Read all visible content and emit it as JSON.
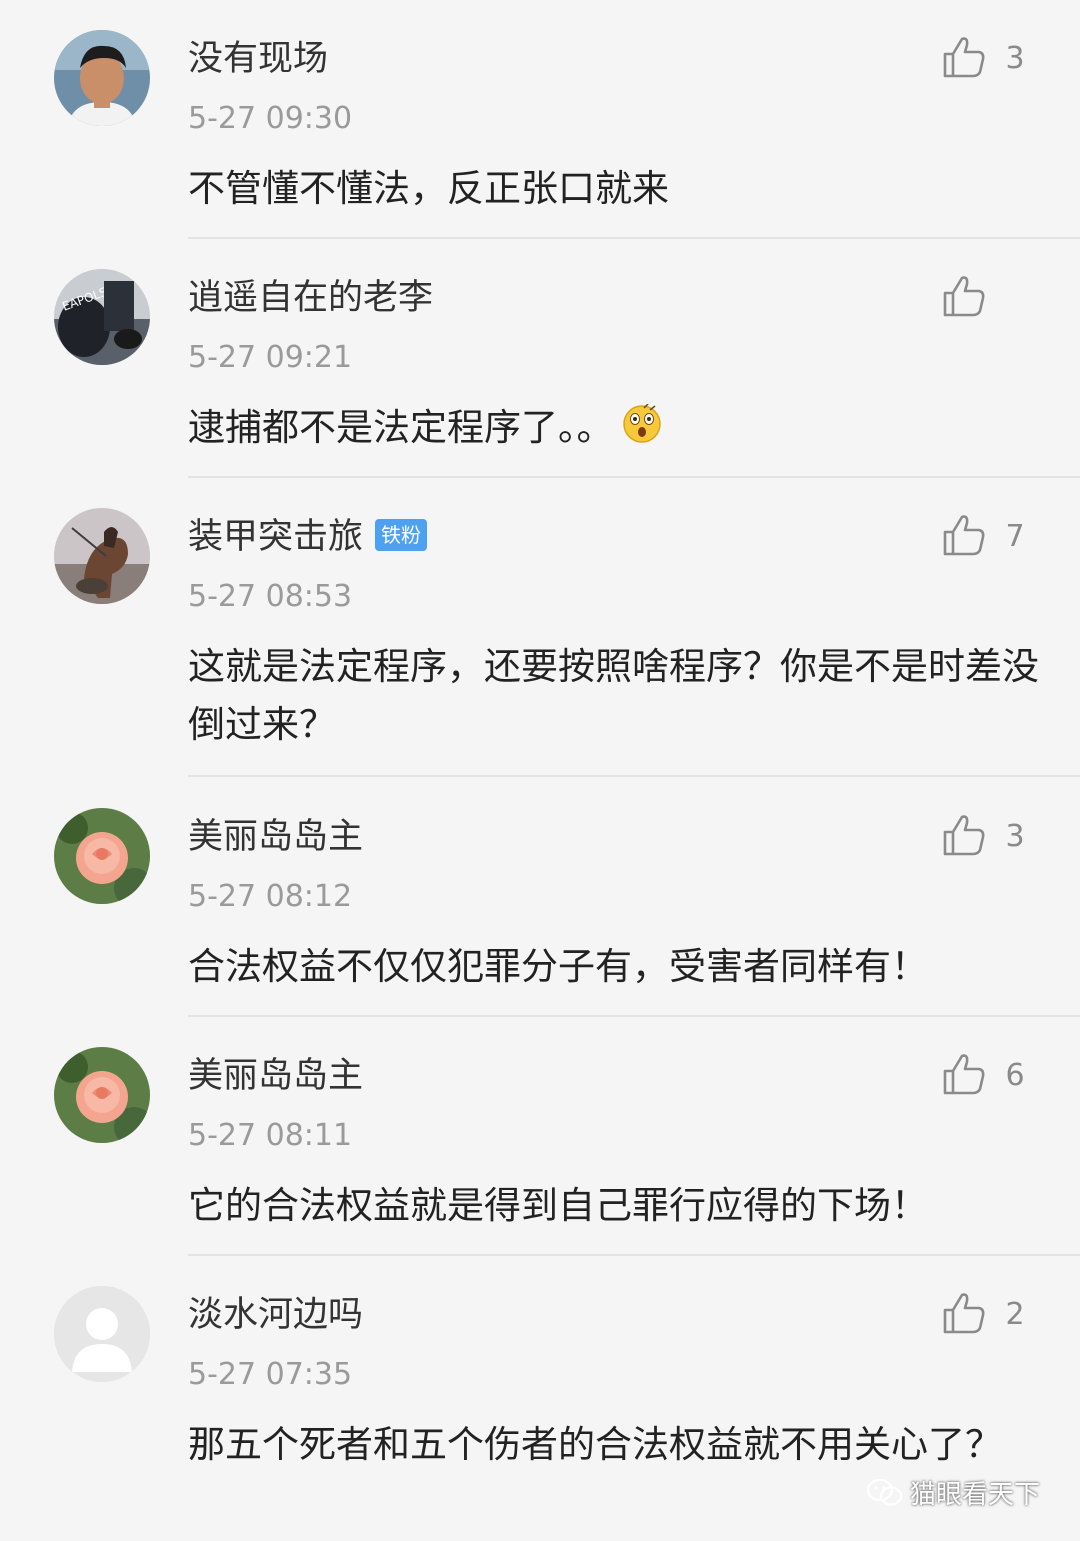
{
  "comments": [
    {
      "username": "没有现场",
      "time": "5-27 09:30",
      "likes": "3",
      "text": "不管懂不懂法，反正张口就来",
      "avatar_icon": "man-portrait-avatar"
    },
    {
      "username": "逍遥自在的老李",
      "time": "5-27 09:21",
      "likes": "",
      "text": "逮捕都不是法定程序了。。",
      "emoji_icon": "shocked-face-emoji",
      "avatar_icon": "photo-avatar"
    },
    {
      "username": "装甲突击旅",
      "badge": "铁粉",
      "time": "5-27 08:53",
      "likes": "7",
      "text": "这就是法定程序，还要按照啥程序？你是不是时差没倒过来？",
      "avatar_icon": "horse-rider-avatar"
    },
    {
      "username": "美丽岛岛主",
      "time": "5-27 08:12",
      "likes": "3",
      "text": "合法权益不仅仅犯罪分子有，受害者同样有！",
      "avatar_icon": "rose-avatar"
    },
    {
      "username": "美丽岛岛主",
      "time": "5-27 08:11",
      "likes": "6",
      "text": "它的合法权益就是得到自己罪行应得的下场！",
      "avatar_icon": "rose-avatar"
    },
    {
      "username": "淡水河边吗",
      "time": "5-27 07:35",
      "likes": "2",
      "text": "那五个死者和五个伤者的合法权益就不用关心了？",
      "avatar_icon": "default-user-avatar"
    }
  ],
  "watermark": {
    "text": "猫眼看天下",
    "icon": "wechat-icon"
  },
  "colors": {
    "background": "#f5f5f5",
    "badge": "#4da1f0",
    "divider": "#e3e3e3",
    "meta_text": "#9a9a9a"
  }
}
